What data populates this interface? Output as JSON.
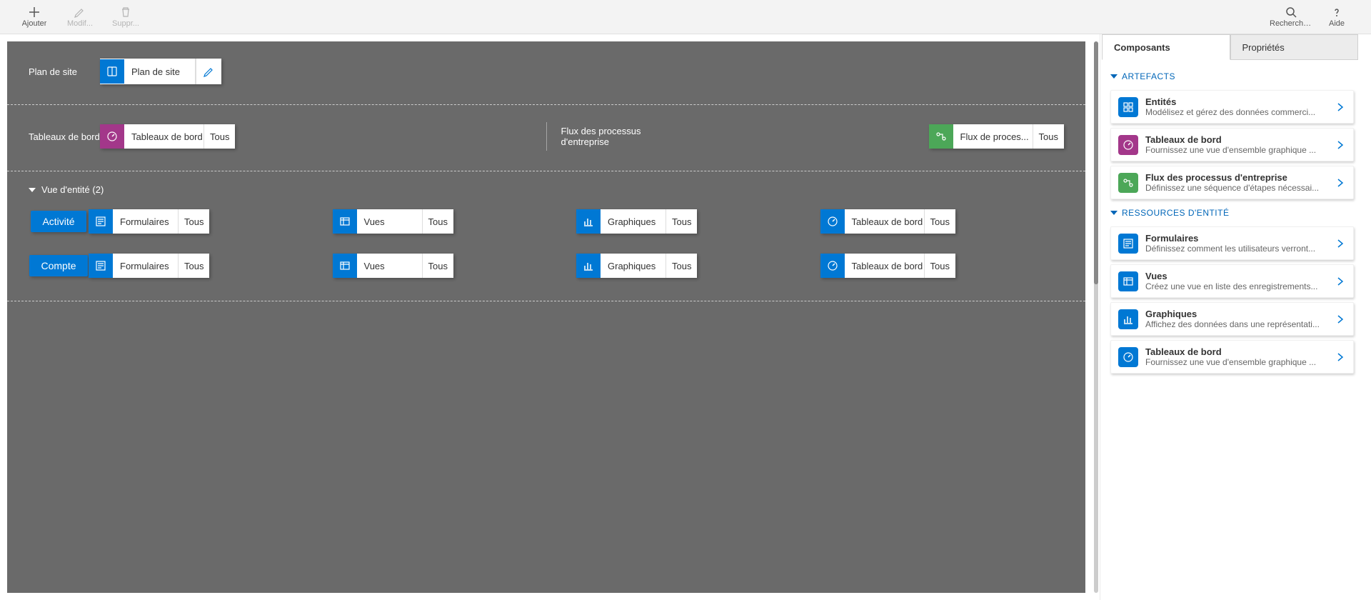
{
  "toolbar": {
    "add": "Ajouter",
    "edit": "Modif...",
    "delete": "Suppr...",
    "search": "Rechercher d...",
    "help": "Aide"
  },
  "canvas": {
    "sitemap_label": "Plan de site",
    "sitemap_tile": "Plan de site",
    "dashboards_label": "Tableaux de bord",
    "dashboards_tile": "Tableaux de bord",
    "dashboards_badge": "Tous",
    "bpf_label": "Flux des processus d'entreprise",
    "bpf_tile": "Flux de proces...",
    "bpf_badge": "Tous",
    "entity_section": "Vue d'entité (2)",
    "entities": [
      {
        "name": "Activité",
        "items": [
          {
            "label": "Formulaires",
            "badge": "Tous",
            "color": "blue",
            "icon": "form"
          },
          {
            "label": "Vues",
            "badge": "Tous",
            "color": "blue",
            "icon": "view"
          },
          {
            "label": "Graphiques",
            "badge": "Tous",
            "color": "blue",
            "icon": "chart"
          },
          {
            "label": "Tableaux de bord",
            "badge": "Tous",
            "color": "blue",
            "icon": "dash"
          }
        ]
      },
      {
        "name": "Compte",
        "items": [
          {
            "label": "Formulaires",
            "badge": "Tous",
            "color": "blue",
            "icon": "form"
          },
          {
            "label": "Vues",
            "badge": "Tous",
            "color": "blue",
            "icon": "view"
          },
          {
            "label": "Graphiques",
            "badge": "Tous",
            "color": "blue",
            "icon": "chart"
          },
          {
            "label": "Tableaux de bord",
            "badge": "Tous",
            "color": "blue",
            "icon": "dash"
          }
        ]
      }
    ]
  },
  "sidebar": {
    "tabs": {
      "components": "Composants",
      "properties": "Propriétés"
    },
    "groups": [
      {
        "title": "ARTEFACTS",
        "items": [
          {
            "title": "Entités",
            "desc": "Modélisez et gérez des données commerci...",
            "color": "blue",
            "icon": "entity"
          },
          {
            "title": "Tableaux de bord",
            "desc": "Fournissez une vue d'ensemble graphique ...",
            "color": "purple",
            "icon": "dash"
          },
          {
            "title": "Flux des processus d'entreprise",
            "desc": "Définissez une séquence d'étapes nécessai...",
            "color": "green",
            "icon": "bpf"
          }
        ]
      },
      {
        "title": "RESSOURCES D'ENTITÉ",
        "items": [
          {
            "title": "Formulaires",
            "desc": "Définissez comment les utilisateurs verront...",
            "color": "blue",
            "icon": "form"
          },
          {
            "title": "Vues",
            "desc": "Créez une vue en liste des enregistrements...",
            "color": "blue",
            "icon": "view"
          },
          {
            "title": "Graphiques",
            "desc": "Affichez des données dans une représentati...",
            "color": "blue",
            "icon": "chart"
          },
          {
            "title": "Tableaux de bord",
            "desc": "Fournissez une vue d'ensemble graphique ...",
            "color": "blue",
            "icon": "dash"
          }
        ]
      }
    ]
  }
}
